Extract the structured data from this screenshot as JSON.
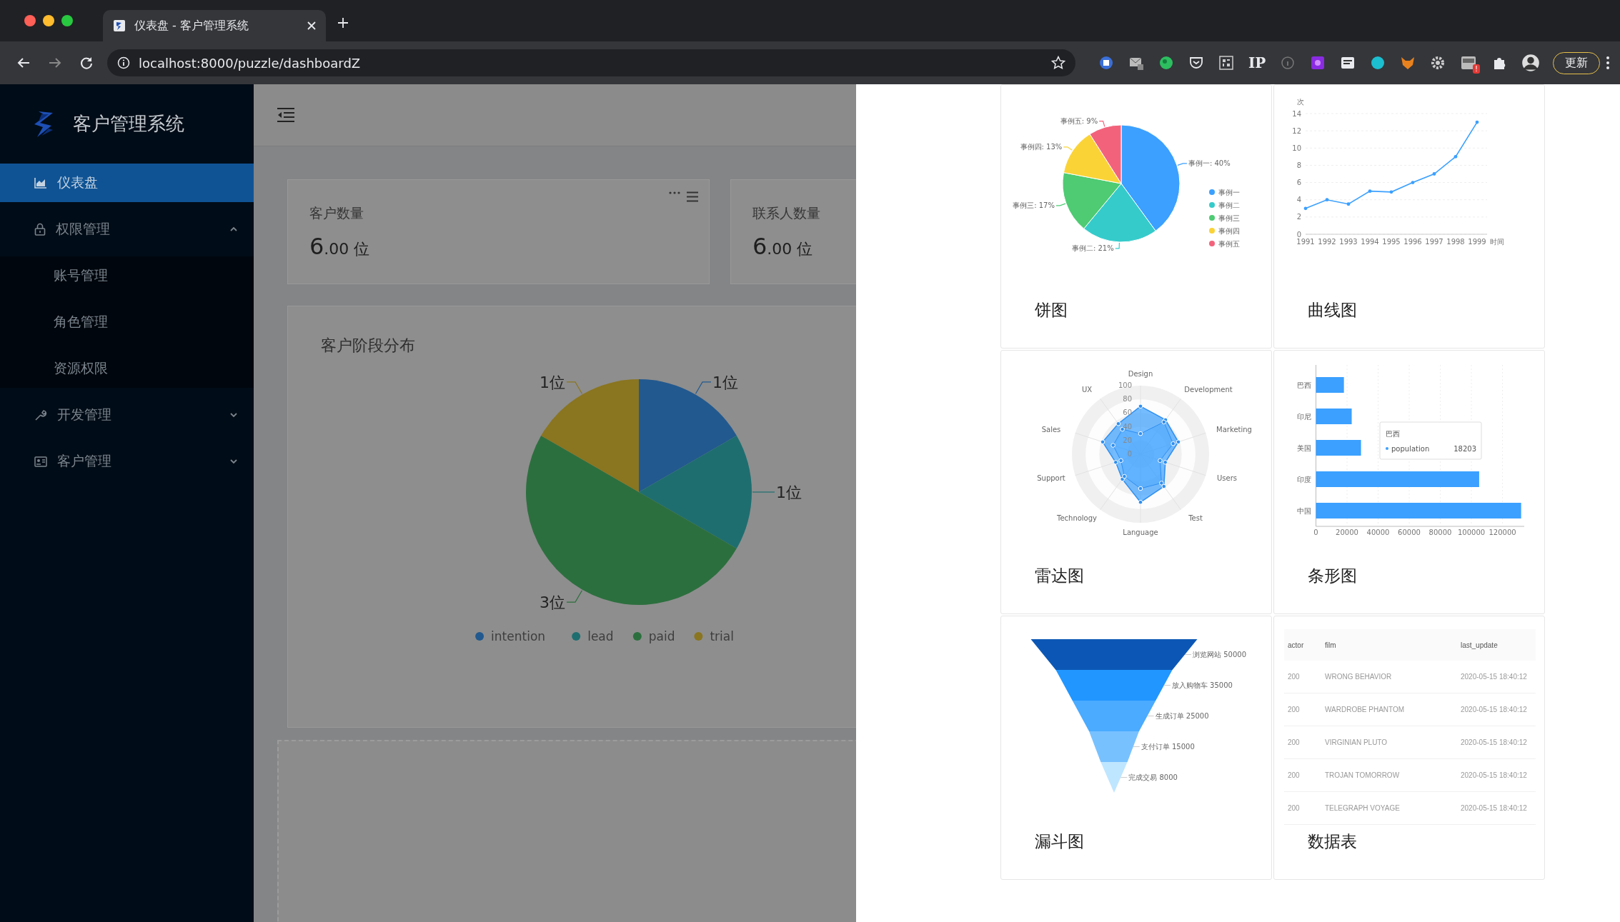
{
  "browser": {
    "tab_title": "仪表盘 - 客户管理系统",
    "address": "localhost:8000/puzzle/dashboardZ",
    "extension_text": "IP",
    "extension_badge": "!",
    "update_button": "更新"
  },
  "sidebar": {
    "app_name": "客户管理系统",
    "items": [
      {
        "label": "仪表盘",
        "selected": true
      },
      {
        "label": "权限管理",
        "selected": false,
        "expanded": true,
        "children": [
          {
            "label": "账号管理",
            "selected": false
          },
          {
            "label": "角色管理",
            "selected": false
          },
          {
            "label": "资源权限",
            "selected": false
          }
        ]
      },
      {
        "label": "开发管理",
        "selected": false,
        "expanded": false
      },
      {
        "label": "客户管理",
        "selected": false,
        "expanded": false
      }
    ]
  },
  "stats": [
    {
      "title": "客户数量",
      "integer": "6",
      "decimal": ".00",
      "unit": "位",
      "has_actions": true
    },
    {
      "title": "联系人数量",
      "integer": "6",
      "decimal": ".00",
      "unit": "位"
    }
  ],
  "stage_card": {
    "title": "客户阶段分布",
    "chart_data": {
      "type": "pie",
      "categories": [
        "intention",
        "lead",
        "paid",
        "trial"
      ],
      "values": [
        1,
        1,
        3,
        1
      ],
      "colors": [
        "#22598f",
        "#1e6e70",
        "#2c6f3e",
        "#8a7520"
      ],
      "data_labels": true,
      "value_labels": [
        "1位",
        "1位",
        "3位",
        "1位"
      ],
      "legend": "bottom"
    }
  },
  "drawer": {
    "cards": [
      {
        "title": "饼图",
        "kind": "chart",
        "chart_data": {
          "type": "pie",
          "categories": [
            "事例一",
            "事例二",
            "事例三",
            "事例四",
            "事例五"
          ],
          "values": [
            40,
            21,
            17,
            13,
            9
          ],
          "colors": [
            "#3ba0ff",
            "#36cbcb",
            "#4ecb73",
            "#fad337",
            "#f2637b"
          ],
          "data_labels": true,
          "value_labels": [
            "事例一: 40%",
            "事例二: 21%",
            "事例三: 17%",
            "事例四: 13%",
            "事例五: 9%"
          ],
          "legend": "right"
        }
      },
      {
        "title": "曲线图",
        "kind": "chart",
        "chart_data": {
          "type": "line",
          "xlabel": "时间",
          "ylabel": "次",
          "x": [
            "1991",
            "1992",
            "1993",
            "1994",
            "1995",
            "1996",
            "1997",
            "1998",
            "1999"
          ],
          "series": [
            {
              "color": "#3ba0ff",
              "values": [
                3,
                4,
                3.5,
                5,
                4.9,
                6,
                7,
                9,
                13
              ]
            }
          ],
          "ylim": [
            0,
            14
          ],
          "yticks": [
            0,
            2,
            4,
            6,
            8,
            10,
            12,
            14
          ],
          "grid": true
        }
      },
      {
        "title": "雷达图",
        "kind": "radar",
        "axes": [
          "Design",
          "Development",
          "Marketing",
          "Users",
          "Test",
          "Language",
          "Technology",
          "Support",
          "Sales",
          "UX"
        ],
        "ticks": [
          "100",
          "80",
          "60",
          "40",
          "20",
          "0"
        ]
      },
      {
        "title": "条形图",
        "kind": "chart",
        "chart_data": {
          "type": "bar",
          "orientation": "horizontal",
          "categories": [
            "巴西",
            "印尼",
            "美国",
            "印度",
            "中国"
          ],
          "series": [
            {
              "name": "population",
              "color": "#3ba0ff",
              "values": [
                18000,
                23000,
                29000,
                105000,
                132000
              ]
            }
          ],
          "xlim": [
            0,
            134000
          ],
          "xticks": [
            0,
            20000,
            40000,
            60000,
            80000,
            100000,
            120000
          ],
          "grid": true
        },
        "tooltip": {
          "title": "巴西",
          "value": "18203"
        }
      },
      {
        "title": "漏斗图",
        "kind": "funnel",
        "stages": [
          {
            "label": "浏览网站 50000",
            "color": "#0c57b5"
          },
          {
            "label": "放入购物车 35000",
            "color": "#2196ff"
          },
          {
            "label": "生成订单 25000",
            "color": "#4aabff"
          },
          {
            "label": "支付订单 15000",
            "color": "#78c1ff"
          },
          {
            "label": "完成交易 8000",
            "color": "#bfe6ff"
          }
        ]
      },
      {
        "title": "数据表",
        "kind": "table",
        "table": {
          "columns": [
            "actor",
            "film",
            "last_update"
          ],
          "rows": [
            [
              "200",
              "WRONG BEHAVIOR",
              "2020-05-15 18:40:12"
            ],
            [
              "200",
              "WARDROBE PHANTOM",
              "2020-05-15 18:40:12"
            ],
            [
              "200",
              "VIRGINIAN PLUTO",
              "2020-05-15 18:40:12"
            ],
            [
              "200",
              "TROJAN TOMORROW",
              "2020-05-15 18:40:12"
            ],
            [
              "200",
              "TELEGRAPH VOYAGE",
              "2020-05-15 18:40:12"
            ]
          ]
        }
      }
    ]
  }
}
